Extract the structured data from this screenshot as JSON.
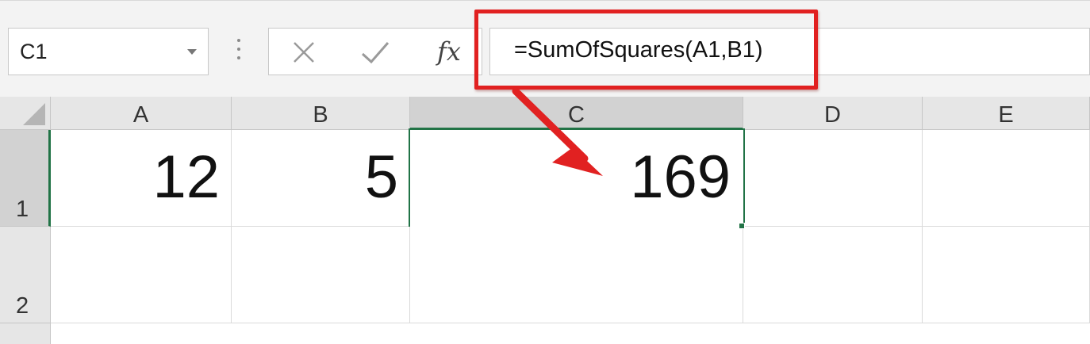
{
  "name_box": {
    "value": "C1"
  },
  "formula_bar": {
    "cancel_icon": "cross-icon",
    "enter_icon": "checkmark-icon",
    "fx_label": "fx",
    "formula": "=SumOfSquares(A1,B1)"
  },
  "columns": [
    {
      "label": "A",
      "selected": false
    },
    {
      "label": "B",
      "selected": false
    },
    {
      "label": "C",
      "selected": true
    },
    {
      "label": "D",
      "selected": false
    },
    {
      "label": "E",
      "selected": false
    }
  ],
  "rows": [
    {
      "label": "1",
      "selected": true,
      "cells": [
        "12",
        "5",
        "169",
        "",
        ""
      ]
    },
    {
      "label": "2",
      "selected": false,
      "cells": [
        "",
        "",
        "",
        "",
        ""
      ]
    }
  ],
  "active_cell": "C1",
  "colors": {
    "accent_green": "#217346",
    "callout_red": "#e12121"
  }
}
